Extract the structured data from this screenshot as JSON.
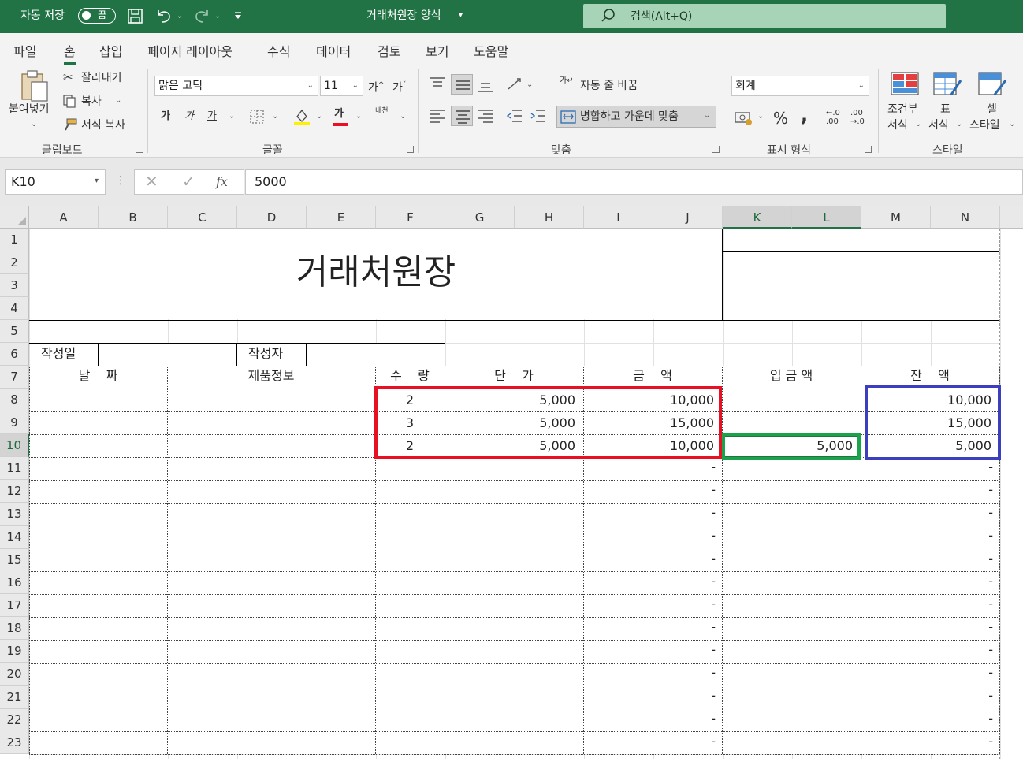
{
  "titlebar": {
    "autosave_label": "자동 저장",
    "autosave_state": "끔",
    "doc_title": "거래처원장 양식",
    "search_placeholder": "검색(Alt+Q)"
  },
  "menu": [
    "파일",
    "홈",
    "삽입",
    "페이지 레이아웃",
    "수식",
    "데이터",
    "검토",
    "보기",
    "도움말"
  ],
  "menu_active": "홈",
  "ribbon": {
    "clipboard": {
      "paste": "붙여넣기",
      "cut": "잘라내기",
      "copy": "복사",
      "format_painter": "서식 복사",
      "group": "클립보드"
    },
    "font": {
      "name": "맑은 고딕",
      "size": "11",
      "bold": "가",
      "italic": "가",
      "underline": "가",
      "font_color_glyph": "가",
      "phonetic": "내천",
      "group": "글꼴"
    },
    "alignment": {
      "wrap": "자동 줄 바꿈",
      "merge": "병합하고 가운데 맞춤",
      "group": "맞춤"
    },
    "number": {
      "format": "회계",
      "percent": "%",
      "comma": ",",
      "group": "표시 형식"
    },
    "styles": {
      "conditional_1": "조건부",
      "conditional_2": "서식",
      "table_1": "표",
      "table_2": "서식",
      "cell_1": "셀",
      "cell_2": "스타일",
      "group": "스타일"
    }
  },
  "formula_bar": {
    "name_box": "K10",
    "formula": "5000",
    "fx": "fx"
  },
  "sheet": {
    "columns": [
      "A",
      "B",
      "C",
      "D",
      "E",
      "F",
      "G",
      "H",
      "I",
      "J",
      "K",
      "L",
      "M",
      "N"
    ],
    "selected_columns": [
      "K",
      "L"
    ],
    "rows": [
      "1",
      "2",
      "3",
      "4",
      "5",
      "6",
      "7",
      "8",
      "9",
      "10",
      "11",
      "12",
      "13",
      "14",
      "15",
      "16",
      "17",
      "18",
      "19",
      "20",
      "21",
      "22",
      "23"
    ],
    "selected_row": "10",
    "title": "거래처원장",
    "created_date_label": "작성일",
    "author_label": "작성자",
    "headers": {
      "date": "날    짜",
      "product": "제품정보",
      "qty": "수    량",
      "price": "단    가",
      "amount": "금    액",
      "deposit": "입 금 액",
      "balance": "잔    액"
    },
    "data_rows": [
      {
        "qty": "2",
        "price": "5,000",
        "amount": "10,000",
        "deposit": "",
        "balance": "10,000"
      },
      {
        "qty": "3",
        "price": "5,000",
        "amount": "15,000",
        "deposit": "",
        "balance": "15,000"
      },
      {
        "qty": "2",
        "price": "5,000",
        "amount": "10,000",
        "deposit": "5,000",
        "balance": "5,000"
      }
    ],
    "empty_mark": "-",
    "highlight_colors": {
      "red": "#e81123",
      "green": "#1aa34a",
      "blue": "#3b3fbf"
    }
  }
}
